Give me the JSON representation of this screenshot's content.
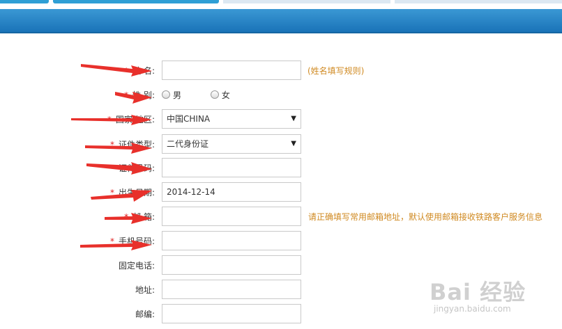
{
  "colors": {
    "header": "#1a73b8",
    "required_star": "#e02020",
    "hint": "#d08a22",
    "arrow": "#e02020"
  },
  "form": {
    "name": {
      "required": "*",
      "label": "姓 名:",
      "value": "",
      "hint": "(姓名填写规则)"
    },
    "gender": {
      "required": "*",
      "label": "性 别:",
      "options": [
        "男",
        "女"
      ]
    },
    "country": {
      "required": "*",
      "label": "国家/地区:",
      "value": "中国CHINA"
    },
    "id_type": {
      "required": "*",
      "label": "证件类型:",
      "value": "二代身份证"
    },
    "id_number": {
      "required": "*",
      "label": "证件号码:",
      "value": ""
    },
    "birth_date": {
      "required": "*",
      "label": "出生日期:",
      "value": "2014-12-14"
    },
    "email": {
      "required": "*",
      "label": "邮 箱:",
      "value": "",
      "hint": "请正确填写常用邮箱地址，默认使用邮箱接收铁路客户服务信息"
    },
    "mobile": {
      "required": "*",
      "label": "手机号码:",
      "value": ""
    },
    "phone": {
      "label": "固定电话:",
      "value": ""
    },
    "address": {
      "label": "地址:",
      "value": ""
    },
    "postcode": {
      "label": "邮编:",
      "value": ""
    }
  },
  "watermark": {
    "logo": "Bai 经验",
    "url": "jingyan.baidu.com"
  }
}
